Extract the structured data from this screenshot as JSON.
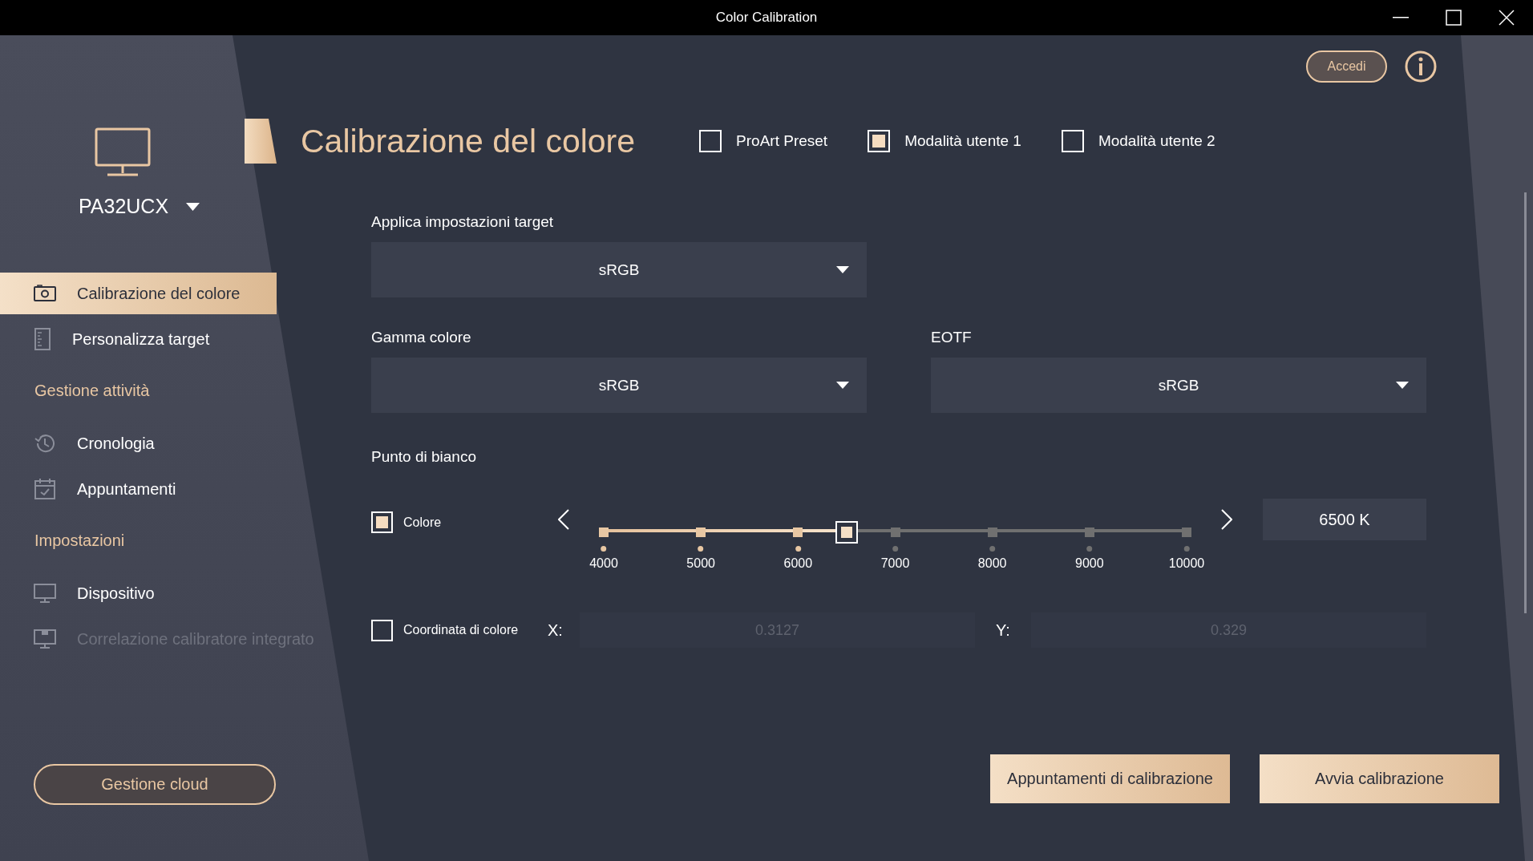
{
  "window": {
    "title": "Color Calibration"
  },
  "sidebar": {
    "device": "PA32UCX",
    "entries": [
      {
        "kind": "item",
        "label": "Calibrazione del colore",
        "selected": true,
        "disabled": false
      },
      {
        "kind": "item",
        "label": "Personalizza target",
        "selected": false,
        "disabled": false
      },
      {
        "kind": "section",
        "label": "Gestione attività"
      },
      {
        "kind": "item",
        "label": "Cronologia",
        "selected": false,
        "disabled": false
      },
      {
        "kind": "item",
        "label": "Appuntamenti",
        "selected": false,
        "disabled": false
      },
      {
        "kind": "section",
        "label": "Impostazioni"
      },
      {
        "kind": "item",
        "label": "Dispositivo",
        "selected": false,
        "disabled": false
      },
      {
        "kind": "item",
        "label": "Correlazione calibratore integrato",
        "selected": false,
        "disabled": true
      }
    ],
    "cloud_button": "Gestione cloud"
  },
  "login_button": "Accedi",
  "heading": "Calibrazione del colore",
  "modes": [
    {
      "label": "ProArt Preset",
      "checked": false
    },
    {
      "label": "Modalità utente 1",
      "checked": true
    },
    {
      "label": "Modalità utente 2",
      "checked": false
    }
  ],
  "target": {
    "label": "Applica impostazioni target",
    "value": "sRGB"
  },
  "gamut": {
    "label": "Gamma colore",
    "value": "sRGB"
  },
  "eotf": {
    "label": "EOTF",
    "value": "sRGB"
  },
  "white_point": {
    "label": "Punto di bianco",
    "color_option": {
      "label": "Colore",
      "checked": true
    },
    "slider": {
      "level": 0.4167,
      "ticks": [
        "4000",
        "5000",
        "6000",
        "7000",
        "8000",
        "9000",
        "10000"
      ]
    },
    "value": "6500 K",
    "coordinate_option": {
      "label": "Coordinata di colore",
      "checked": false
    },
    "x_label": "X:",
    "x_value": "0.3127",
    "y_label": "Y:",
    "y_value": "0.329"
  },
  "actions": [
    "Appuntamenti di calibrazione",
    "Avvia calibrazione"
  ]
}
